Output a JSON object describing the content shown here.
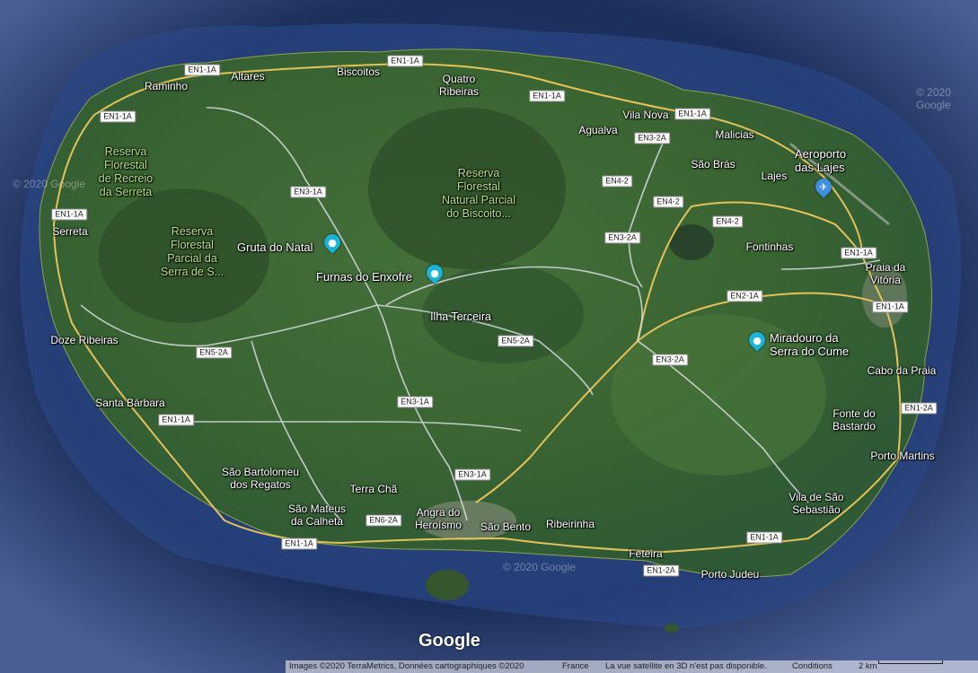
{
  "places": {
    "raminho": "Raminho",
    "altares": "Altares",
    "biscoitos": "Biscoitos",
    "quatro_ribeiras": "Quatro\nRibeiras",
    "agualva": "Agualva",
    "vila_nova": "Vila Nova",
    "malicias": "Malicias",
    "sao_bras": "São Brás",
    "lajes": "Lajes",
    "fontinhas": "Fontinhas",
    "praia_da_vitoria": "Praia da\nVitória",
    "serreta": "Serreta",
    "doze_ribeiras": "Doze Ribeiras",
    "santa_barbara": "Santa Bárbara",
    "sao_bartolomeu": "São Bartolomeu\ndos Regatos",
    "terra_cha": "Terra Chã",
    "sao_mateus": "São Mateus\nda Calheta",
    "angra": "Angra do\nHeroísmo",
    "sao_bento": "São Bento",
    "ribeirinha": "Ribeirinha",
    "feteira": "Feteira",
    "porto_judeu": "Porto Judeu",
    "vila_sao_sebastiao": "Vila de São\nSebastião",
    "porto_martins": "Porto Martins",
    "fonte_do_bastardo": "Fonte do\nBastardo",
    "cabo_da_praia": "Cabo da Praia",
    "ilha_terceira": "Ilha Terceira"
  },
  "reserves": {
    "serreta": "Reserva\nFlorestal\nde Recreio\nda Serreta",
    "serra_de_s": "Reserva\nFlorestal\nParcial da\nSerra de S...",
    "biscoito": "Reserva\nFlorestal\nNatural Parcial\ndo Biscoito..."
  },
  "pois": {
    "gruta_do_natal": "Gruta do Natal",
    "furnas_do_enxofre": "Furnas do Enxofre",
    "aeroporto": "Aeroporto\ndas Lajes",
    "miradouro": "Miradouro da\nSerra do Cume"
  },
  "roads": {
    "en1_1a": "EN1-1A",
    "en3_1a": "EN3-1A",
    "en3_2a": "EN3-2A",
    "en4_2": "EN4-2",
    "en2_1a": "EN2-1A",
    "en5_2a": "EN5-2A",
    "en6_2a": "EN6-2A",
    "en1_2a": "EN1-2A"
  },
  "branding": {
    "logo": "Google",
    "watermark": "© 2020 Google"
  },
  "footer": {
    "imagery": "Images ©2020 TerraMetrics, Données cartographiques ©2020",
    "country": "France",
    "sat3d": "La vue satellite en 3D n'est pas disponible.",
    "conditions": "Conditions",
    "scale": "2 km"
  },
  "colors": {
    "ocean": "#1d2f5c",
    "land": "#3f6b34",
    "highway": "#e3c35a",
    "road": "#d9dde2",
    "poi_pin": "#1ab4d8"
  }
}
